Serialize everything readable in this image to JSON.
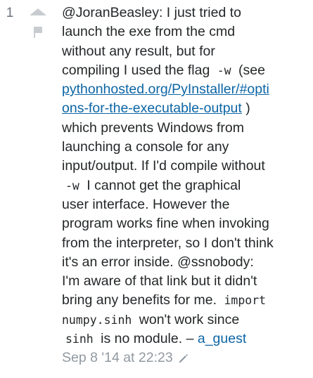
{
  "comment": {
    "score": "1",
    "icons": {
      "upvote": "upvote-arrow-icon",
      "flag": "flag-icon",
      "edit": "pencil-icon"
    },
    "text": {
      "t1": "@JoranBeasley: I just tried to\nlaunch the exe from the cmd\nwithout any result, but for\ncompiling I used the flag ",
      "code1": "-w",
      "t2": " (see\n",
      "link": "pythonhosted.org/PyInstaller/#opti\nons-for-the-executable-output",
      "t3": " )\nwhich prevents Windows from\nlaunching a console for any\ninput/output. If I'd compile without\n",
      "code2": "-w",
      "t4": " I cannot get the graphical\nuser interface. However the\nprogram works fine when invoking\nfrom the interpreter, so I don't think\nit's an error inside. @ssnobody:\nI'm aware of that link but it didn't\nbring any benefits for me. ",
      "code3": "import\nnumpy.sinh",
      "t5": " won't work since\n",
      "code4": "sinh",
      "t6": " is no module. – ",
      "user": "a_guest",
      "t7": "\n",
      "date": "Sep 8 '14 at 22:23"
    },
    "colors": {
      "text": "#242729",
      "link": "#0c65a5",
      "muted": "#9199a1",
      "vote": "#c8ccd0"
    }
  }
}
